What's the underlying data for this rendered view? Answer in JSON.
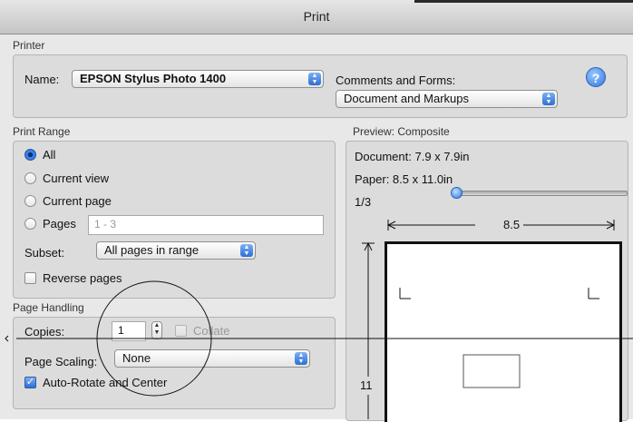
{
  "window": {
    "title": "Print"
  },
  "printer": {
    "group_title": "Printer",
    "name_label": "Name:",
    "name_value": "EPSON Stylus Photo 1400",
    "comments_label": "Comments and Forms:",
    "comments_value": "Document and Markups",
    "help_glyph": "?"
  },
  "print_range": {
    "group_title": "Print Range",
    "options": [
      {
        "label": "All",
        "selected": true
      },
      {
        "label": "Current view",
        "selected": false
      },
      {
        "label": "Current page",
        "selected": false
      },
      {
        "label": "Pages",
        "selected": false
      }
    ],
    "pages_value": "1 - 3",
    "subset_label": "Subset:",
    "subset_value": "All pages in range",
    "reverse_label": "Reverse pages",
    "reverse_checked": false
  },
  "page_handling": {
    "group_title": "Page Handling",
    "copies_label": "Copies:",
    "copies_value": "1",
    "collate_label": "Collate",
    "collate_checked": false,
    "scaling_label": "Page Scaling:",
    "scaling_value": "None",
    "auto_rotate_label": "Auto-Rotate and Center",
    "auto_rotate_checked": true
  },
  "preview": {
    "group_title": "Preview: Composite",
    "document_size": "Document: 7.9 x 7.9in",
    "paper_size": "Paper: 8.5 x 11.0in",
    "page_indicator": "1/3",
    "width_label": "8.5",
    "height_label": "11"
  },
  "icons": {
    "popup_arrows": "updown-arrows-icon",
    "help": "help-icon",
    "checkmark": "checkmark-icon"
  },
  "colors": {
    "accent": "#2c6fd6",
    "dialog_bg": "#e8e8e8"
  }
}
